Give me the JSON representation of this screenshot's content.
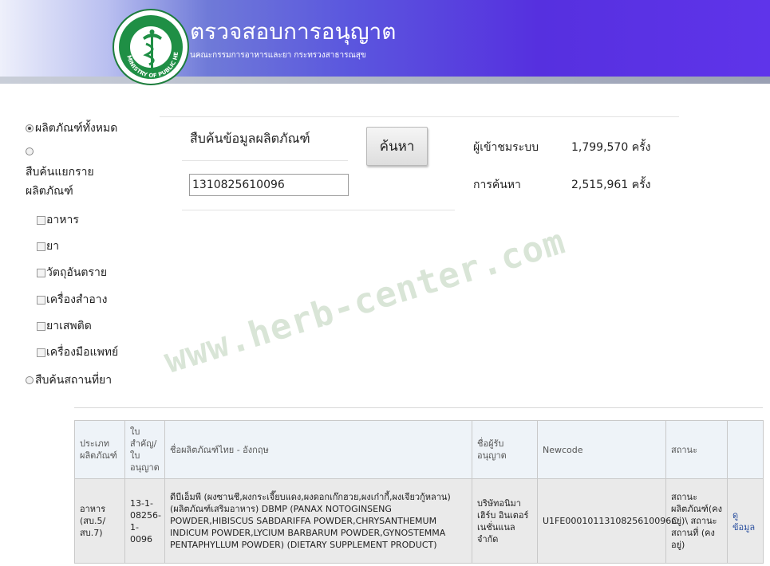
{
  "header": {
    "title": "ตรวจสอบการอนุญาต",
    "subtitle": "นคณะกรรมการอาหารและยา กระทรวงสาธารณสุข",
    "logo_text": "MINISTRY OF PUBLIC HEALTH"
  },
  "sidebar": {
    "all_products": "ผลิตภัณฑ์ทั้งหมด",
    "by_category_line1": "สืบค้นแยกราย",
    "by_category_line2": "ผลิตภัณฑ์",
    "categories": [
      {
        "label": "อาหาร"
      },
      {
        "label": "ยา"
      },
      {
        "label": "วัตถุอันตราย"
      },
      {
        "label": "เครื่องสำอาง"
      },
      {
        "label": "ยาเสพติด"
      },
      {
        "label": "เครื่องมือแพทย์"
      }
    ],
    "drug_places": "สืบค้นสถานที่ยา"
  },
  "search": {
    "title": "สืบค้นข้อมูลผลิตภัณฑ์",
    "value": "1310825610096",
    "placeholder": "",
    "button_label": "ค้นหา"
  },
  "stats": {
    "visitors_label": "ผู้เข้าชมระบบ",
    "visitors_value": "1,799,570 ครั้ง",
    "searches_label": "การค้นหา",
    "searches_value": "2,515,961 ครั้ง"
  },
  "watermark": "www.herb-center.com",
  "table": {
    "headers": [
      "ประเภทผลิตภัณฑ์",
      "ใบสำคัญ/ใบอนุญาต",
      "ชื่อผลิตภัณฑ์ไทย - อังกฤษ",
      "ชื่อผู้รับอนุญาต",
      "Newcode",
      "สถานะ",
      ""
    ],
    "rows": [
      {
        "type": "อาหาร (สบ.5/สบ.7)",
        "license": "13-1-08256-1-0096",
        "name": "ดีบีเอ็มพี (ผงซานชี,ผงกระเจี๊ยบแดง,ผงดอกเก๊กฮวย,ผงเก๋ากี้,ผงเจียวกู้หลาน) (ผลิตภัณฑ์เสริมอาหาร) DBMP (PANAX NOTOGINSENG POWDER,HIBISCUS SABDARIFFA POWDER,CHRYSANTHEMUM INDICUM POWDER,LYCIUM BARBARUM POWDER,GYNOSTEMMA PENTAPHYLLUM POWDER) (DIETARY SUPPLEMENT PRODUCT)",
        "licensee": "บริษัทอนิมา เฮิร์บ อินเตอร์เนชั่นแนล จำกัด",
        "newcode": "U1FE0001011310825610096C",
        "status": "สถานะผลิตภัณฑ์(คงอยู่)\\ สถานะสถานที่ (คงอยู่)",
        "detail": "ดูข้อมูล"
      }
    ]
  }
}
